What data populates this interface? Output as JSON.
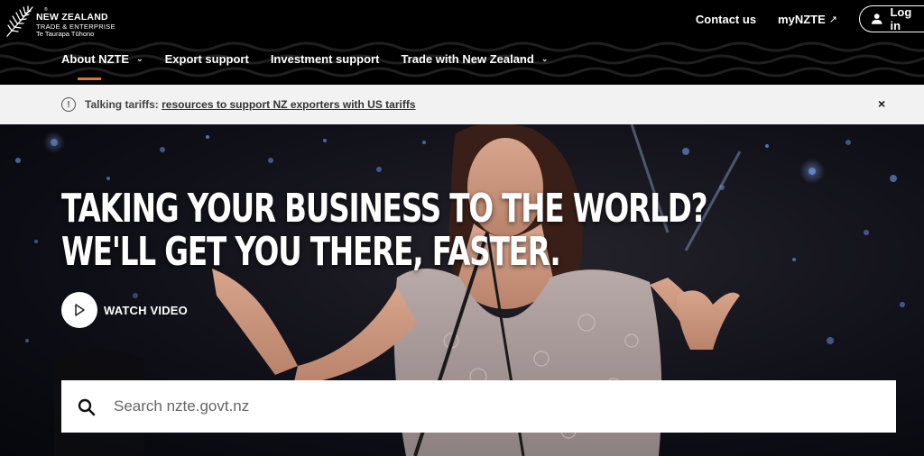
{
  "brand": {
    "line1": "NEW ZEALAND",
    "line2": "TRADE & ENTERPRISE",
    "line3": "Te Taurapa Tūhono",
    "reg": "®"
  },
  "top_links": {
    "contact": "Contact us",
    "mynzte": "myNZTE",
    "mynzte_icon": "external-arrow-icon",
    "login": "Log in"
  },
  "nav": {
    "items": [
      {
        "label": "About NZTE",
        "has_dropdown": true,
        "active": true
      },
      {
        "label": "Export support",
        "has_dropdown": false
      },
      {
        "label": "Investment support",
        "has_dropdown": false
      },
      {
        "label": "Trade with New Zealand",
        "has_dropdown": true
      }
    ],
    "accent_color": "#e8702a"
  },
  "alert": {
    "prefix": "Talking tariffs:",
    "link_text": "resources to support NZ exporters with US tariffs",
    "close": "×",
    "icon": "info-icon"
  },
  "hero": {
    "headline_line1": "TAKING YOUR BUSINESS TO THE WORLD?",
    "headline_line2": "WE'LL GET YOU THERE, FASTER.",
    "watch_label": "WATCH VIDEO"
  },
  "search": {
    "placeholder": "Search nzte.govt.nz",
    "value": ""
  }
}
